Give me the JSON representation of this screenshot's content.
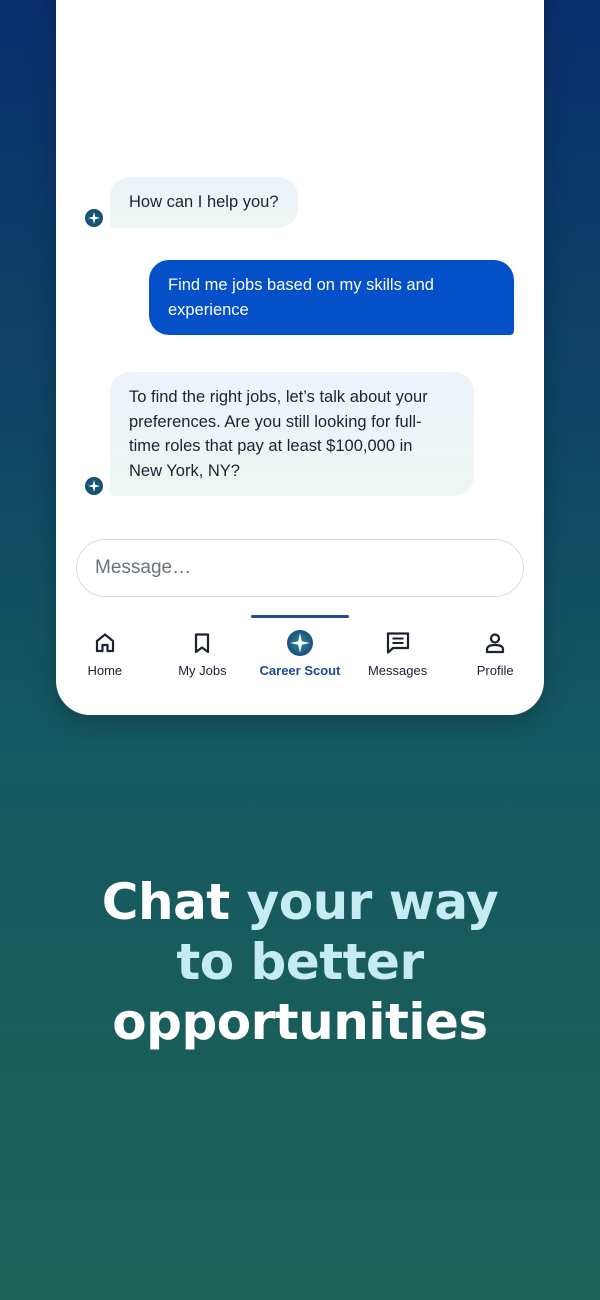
{
  "chat": {
    "greeting": "How can I help you?",
    "user_message_line1": "Find me jobs based on my skills and",
    "user_message_line2": "experience",
    "bot_reply_lines": [
      "To find the right jobs, let’s talk about your",
      "preferences. Are you still looking for full-",
      "time roles that pay at least $100,000 in",
      "New York, NY?"
    ]
  },
  "input": {
    "placeholder": "Message…"
  },
  "nav": {
    "items": [
      {
        "label": "Home",
        "icon": "home-icon"
      },
      {
        "label": "My Jobs",
        "icon": "bookmark-icon"
      },
      {
        "label": "Career Scout",
        "icon": "compass-star-icon",
        "active": true
      },
      {
        "label": "Messages",
        "icon": "chat-icon"
      },
      {
        "label": "Profile",
        "icon": "person-icon"
      }
    ]
  },
  "headline": {
    "part1": "Chat ",
    "part2": "your way",
    "part3": "to better",
    "part4": "opportunities"
  },
  "colors": {
    "accent": "#0450c8",
    "active_nav": "#1a4a92",
    "headline_highlight": "#c6ecf3"
  }
}
